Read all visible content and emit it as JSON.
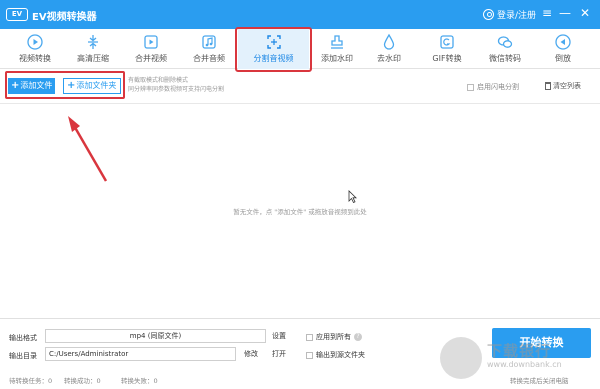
{
  "titlebar": {
    "logo_text": "EV",
    "title": "EV视频转换器",
    "login_label": "登录/注册",
    "bg_color": "#2a9df0"
  },
  "toolbar": {
    "items": [
      {
        "label": "视频转换",
        "icon": "video-convert-icon"
      },
      {
        "label": "高清压缩",
        "icon": "compress-icon"
      },
      {
        "label": "合并视频",
        "icon": "merge-video-icon"
      },
      {
        "label": "合并音频",
        "icon": "merge-audio-icon"
      },
      {
        "label": "分割音视频",
        "icon": "split-icon",
        "active": true
      },
      {
        "label": "添加水印",
        "icon": "watermark-stamp-icon"
      },
      {
        "label": "去水印",
        "icon": "remove-watermark-icon"
      },
      {
        "label": "GIF转换",
        "icon": "gif-icon"
      },
      {
        "label": "微信转码",
        "icon": "wechat-icon"
      },
      {
        "label": "倒放",
        "icon": "reverse-icon"
      }
    ]
  },
  "subbar": {
    "add_file": "添加文件",
    "add_folder": "添加文件夹",
    "hint_line1": "有截取模式和删除模式",
    "hint_line2": "同分辨率同参数视频可支持闪电分割",
    "flash_split_label": "启用闪电分割",
    "clear_list": "清空列表"
  },
  "content": {
    "empty_text": "暂无文件，点 \"添加文件\" 或拖放音视频到此处"
  },
  "bottom": {
    "output_format_label": "输出格式",
    "output_format_value": "mp4 (同原文件)",
    "settings_btn": "设置",
    "apply_all_label": "应用到所有",
    "output_dir_label": "输出目录",
    "output_dir_value": "C:/Users/Administrator",
    "modify_btn": "修改",
    "open_btn": "打开",
    "output_to_source_label": "输出到源文件夹",
    "start_btn": "开始转换",
    "status_pending": "待转换任务：0",
    "status_success": "转换成功：0",
    "status_failed": "转换失败：0",
    "after_label": "转换完成后关闭电脑"
  },
  "watermark": {
    "name": "下载银行",
    "url": "www.downbank.cn"
  },
  "colors": {
    "accent": "#2a9df0",
    "highlight_red": "#d9363e"
  }
}
